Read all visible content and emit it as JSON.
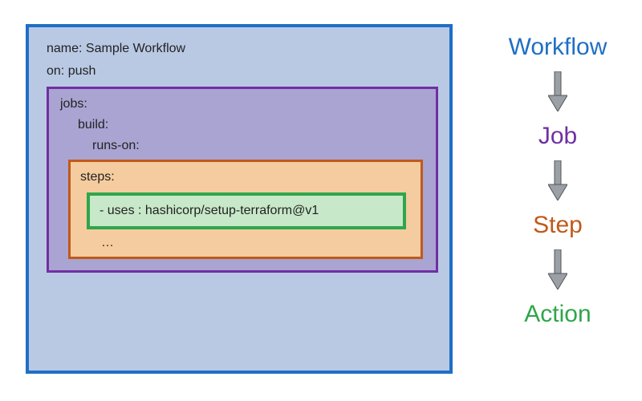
{
  "workflow": {
    "name_line": "name: Sample Workflow",
    "on_line": "on: push",
    "jobs_label": "jobs:",
    "build_label": "build:",
    "runs_on_label": "runs-on:",
    "steps_label": "steps:",
    "action_line": "- uses : hashicorp/setup-terraform@v1",
    "ellipsis": "…"
  },
  "legend": {
    "workflow": "Workflow",
    "job": "Job",
    "step": "Step",
    "action": "Action"
  },
  "colors": {
    "workflow": "#1f6fc4",
    "job": "#702fa3",
    "step": "#c05a1a",
    "action": "#2ea64a"
  }
}
